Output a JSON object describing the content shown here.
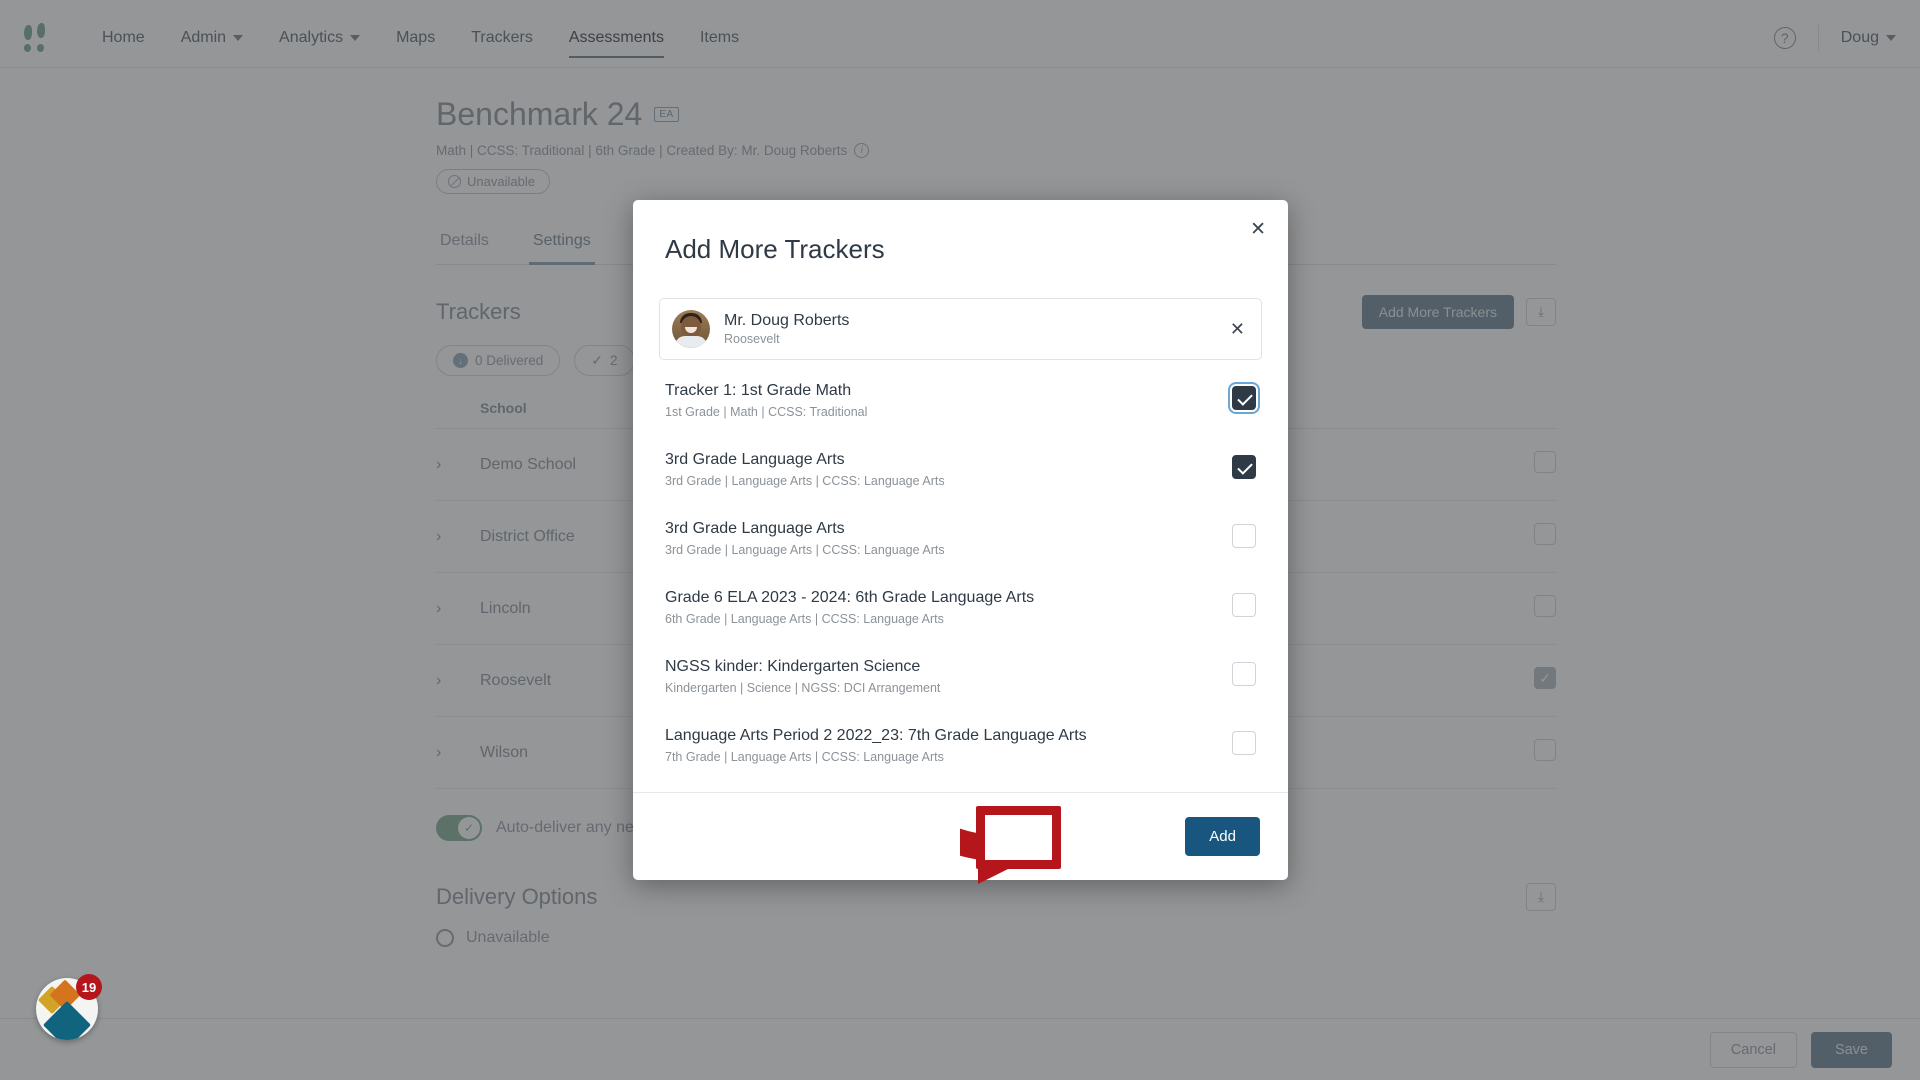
{
  "navbar": {
    "brand_icon": "logo-icon",
    "items": [
      {
        "label": "Home",
        "has_caret": false,
        "active": false
      },
      {
        "label": "Admin",
        "has_caret": true,
        "active": false
      },
      {
        "label": "Analytics",
        "has_caret": true,
        "active": false
      },
      {
        "label": "Maps",
        "has_caret": false,
        "active": false
      },
      {
        "label": "Trackers",
        "has_caret": false,
        "active": false
      },
      {
        "label": "Assessments",
        "has_caret": false,
        "active": true
      },
      {
        "label": "Items",
        "has_caret": false,
        "active": false
      }
    ],
    "help_icon": "question-mark-icon",
    "user_label": "Doug",
    "user_caret_icon": "chevron-down-icon"
  },
  "page": {
    "title": "Benchmark 24",
    "title_badge": "EA",
    "meta": "Math  |  CCSS: Traditional  |  6th Grade  |  Created By: Mr. Doug Roberts",
    "meta_info_icon": "info-icon",
    "status_pill": "Unavailable",
    "status_pill_icon": "no-entry-icon",
    "tabs": [
      {
        "label": "Details",
        "active": false
      },
      {
        "label": "Settings",
        "active": true
      }
    ],
    "trackers_section": {
      "heading": "Trackers",
      "add_more_button": "Add More Trackers",
      "export_icon": "download-icon",
      "chips": [
        {
          "label": "0 Delivered",
          "icon": "download-circle-icon"
        },
        {
          "label": "2",
          "icon": "check-icon"
        }
      ],
      "table": {
        "columns": [
          "School",
          ""
        ],
        "rows": [
          {
            "school": "Demo School",
            "expand_icon": "chevron-right-icon",
            "checked": false
          },
          {
            "school": "District Office",
            "expand_icon": "chevron-right-icon",
            "checked": false
          },
          {
            "school": "Lincoln",
            "expand_icon": "chevron-right-icon",
            "checked": false
          },
          {
            "school": "Roosevelt",
            "expand_icon": "chevron-right-icon",
            "checked": true
          },
          {
            "school": "Wilson",
            "expand_icon": "chevron-right-icon",
            "checked": false
          }
        ]
      },
      "auto_deliver_label": "Auto-deliver any new matching trackers.",
      "auto_deliver_on": true,
      "auto_deliver_info_icon": "info-icon"
    },
    "delivery_options": {
      "heading": "Delivery Options",
      "export_icon": "download-icon",
      "options": [
        {
          "label": "Unavailable",
          "selected": true
        }
      ]
    },
    "footer": {
      "cancel_label": "Cancel",
      "save_label": "Save"
    }
  },
  "support_widget": {
    "name": "support-launcher",
    "badge_count": "19",
    "badge_color": "#b4161b"
  },
  "modal": {
    "title": "Add More Trackers",
    "close_icon": "close-icon",
    "person": {
      "name": "Mr. Doug Roberts",
      "school": "Roosevelt",
      "remove_icon": "close-icon",
      "avatar": "user-avatar"
    },
    "trackers": [
      {
        "name": "Tracker 1: 1st Grade Math",
        "meta": "1st Grade  |  Math  |  CCSS: Traditional",
        "checked": true,
        "focused": true
      },
      {
        "name": "3rd Grade Language Arts",
        "meta": "3rd Grade  |  Language Arts  |  CCSS: Language Arts",
        "checked": true,
        "focused": false
      },
      {
        "name": "3rd Grade Language Arts",
        "meta": "3rd Grade  |  Language Arts  |  CCSS: Language Arts",
        "checked": false,
        "focused": false
      },
      {
        "name": "Grade 6 ELA 2023 - 2024: 6th Grade Language Arts",
        "meta": "6th Grade  |  Language Arts  |  CCSS: Language Arts",
        "checked": false,
        "focused": false
      },
      {
        "name": "NGSS kinder: Kindergarten Science",
        "meta": "Kindergarten  |  Science  |  NGSS: DCI Arrangement",
        "checked": false,
        "focused": false
      },
      {
        "name": "Language Arts Period 2 2022_23: 7th Grade Language Arts",
        "meta": "7th Grade  |  Language Arts  |  CCSS: Language Arts",
        "checked": false,
        "focused": false
      }
    ],
    "add_button": "Add"
  },
  "annotation": {
    "highlight_color": "#b4161b",
    "arrow_icon": "curved-arrow-right-icon",
    "target": "Add"
  }
}
